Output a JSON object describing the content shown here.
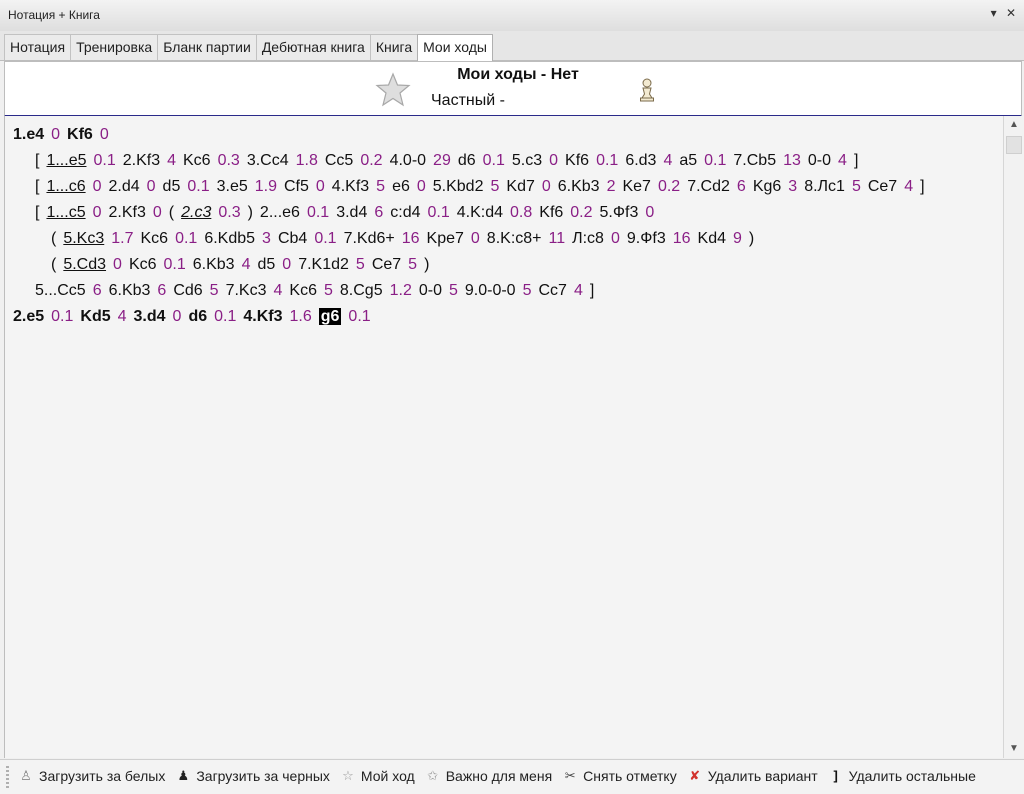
{
  "window": {
    "title": "Нотация + Книга",
    "controls": [
      "▾",
      "✕"
    ]
  },
  "tabs": [
    {
      "label": "Нотация",
      "active": false
    },
    {
      "label": "Тренировка",
      "active": false
    },
    {
      "label": "Бланк партии",
      "active": false
    },
    {
      "label": "Дебютная книга",
      "active": false
    },
    {
      "label": "Книга",
      "active": false
    },
    {
      "label": "Мои ходы",
      "active": true
    }
  ],
  "header": {
    "title": "Мои ходы - Нет",
    "subtitle": "Частный -"
  },
  "notation_lines": [
    {
      "tokens": [
        {
          "t": "1.e4",
          "s": "b"
        },
        {
          "t": "0",
          "c": "w"
        },
        {
          "t": "Kf6",
          "s": "b"
        },
        {
          "t": "0",
          "c": "w"
        }
      ]
    },
    {
      "tokens": [
        {
          "t": "["
        },
        {
          "t": "1...e5",
          "s": "u"
        },
        {
          "t": "0.1",
          "c": "w"
        },
        {
          "t": "2.Kf3"
        },
        {
          "t": "4",
          "c": "w"
        },
        {
          "t": "Kc6"
        },
        {
          "t": "0.3",
          "c": "w"
        },
        {
          "t": "3.Cc4"
        },
        {
          "t": "1.8",
          "c": "w"
        },
        {
          "t": "Cc5"
        },
        {
          "t": "0.2",
          "c": "w"
        },
        {
          "t": "4.0-0"
        },
        {
          "t": "29",
          "c": "w"
        },
        {
          "t": "d6"
        },
        {
          "t": "0.1",
          "c": "w"
        },
        {
          "t": "5.c3"
        },
        {
          "t": "0",
          "c": "w"
        },
        {
          "t": "Kf6"
        },
        {
          "t": "0.1",
          "c": "w"
        },
        {
          "t": "6.d3"
        },
        {
          "t": "4",
          "c": "w"
        },
        {
          "t": "a5"
        },
        {
          "t": "0.1",
          "c": "w"
        },
        {
          "t": "7.Cb5"
        },
        {
          "t": "13",
          "c": "w"
        },
        {
          "t": "0-0"
        },
        {
          "t": "4",
          "c": "w"
        },
        {
          "t": "]"
        }
      ]
    },
    {
      "tokens": [
        {
          "t": "["
        },
        {
          "t": "1...c6",
          "s": "u"
        },
        {
          "t": "0",
          "c": "w"
        },
        {
          "t": "2.d4"
        },
        {
          "t": "0",
          "c": "w"
        },
        {
          "t": "d5"
        },
        {
          "t": "0.1",
          "c": "w"
        },
        {
          "t": "3.e5"
        },
        {
          "t": "1.9",
          "c": "w"
        },
        {
          "t": "Cf5"
        },
        {
          "t": "0",
          "c": "w"
        },
        {
          "t": "4.Kf3"
        },
        {
          "t": "5",
          "c": "w"
        },
        {
          "t": "e6"
        },
        {
          "t": "0",
          "c": "w"
        },
        {
          "t": "5.Kbd2"
        },
        {
          "t": "5",
          "c": "w"
        },
        {
          "t": "Kd7"
        },
        {
          "t": "0",
          "c": "w"
        },
        {
          "t": "6.Kb3"
        },
        {
          "t": "2",
          "c": "w"
        },
        {
          "t": "Ke7"
        },
        {
          "t": "0.2",
          "c": "w"
        },
        {
          "t": "7.Cd2"
        },
        {
          "t": "6",
          "c": "w"
        },
        {
          "t": "Kg6"
        },
        {
          "t": "3",
          "c": "w"
        },
        {
          "t": "8.Лc1"
        },
        {
          "t": "5",
          "c": "w"
        },
        {
          "t": "Ce7"
        },
        {
          "t": "4",
          "c": "w"
        },
        {
          "t": "]"
        }
      ]
    },
    {
      "tokens": [
        {
          "t": "["
        },
        {
          "t": "1...c5",
          "s": "u"
        },
        {
          "t": "0",
          "c": "w"
        },
        {
          "t": "2.Kf3"
        },
        {
          "t": "0",
          "c": "w"
        },
        {
          "t": "("
        },
        {
          "t": "2.c3",
          "s": "ui"
        },
        {
          "t": "0.3",
          "c": "w"
        },
        {
          "t": ")"
        },
        {
          "t": "2...e6"
        },
        {
          "t": "0.1",
          "c": "w"
        },
        {
          "t": "3.d4"
        },
        {
          "t": "6",
          "c": "w"
        },
        {
          "t": "c:d4"
        },
        {
          "t": "0.1",
          "c": "w"
        },
        {
          "t": "4.K:d4"
        },
        {
          "t": "0.8",
          "c": "w"
        },
        {
          "t": "Kf6"
        },
        {
          "t": "0.2",
          "c": "w"
        },
        {
          "t": "5.Фf3"
        },
        {
          "t": "0",
          "c": "w"
        }
      ]
    },
    {
      "tokens": [
        {
          "t": "("
        },
        {
          "t": "5.Kc3",
          "s": "u"
        },
        {
          "t": "1.7",
          "c": "w"
        },
        {
          "t": "Kc6"
        },
        {
          "t": "0.1",
          "c": "w"
        },
        {
          "t": "6.Kdb5"
        },
        {
          "t": "3",
          "c": "w"
        },
        {
          "t": "Cb4"
        },
        {
          "t": "0.1",
          "c": "w"
        },
        {
          "t": "7.Kd6+"
        },
        {
          "t": "16",
          "c": "w"
        },
        {
          "t": "Kpe7"
        },
        {
          "t": "0",
          "c": "w"
        },
        {
          "t": "8.K:c8+"
        },
        {
          "t": "11",
          "c": "w"
        },
        {
          "t": "Л:c8"
        },
        {
          "t": "0",
          "c": "w"
        },
        {
          "t": "9.Фf3"
        },
        {
          "t": "16",
          "c": "w"
        },
        {
          "t": "Kd4"
        },
        {
          "t": "9",
          "c": "w"
        },
        {
          "t": ")"
        }
      ]
    },
    {
      "tokens": [
        {
          "t": "("
        },
        {
          "t": "5.Cd3",
          "s": "u"
        },
        {
          "t": "0",
          "c": "w"
        },
        {
          "t": "Kc6"
        },
        {
          "t": "0.1",
          "c": "w"
        },
        {
          "t": "6.Kb3"
        },
        {
          "t": "4",
          "c": "w"
        },
        {
          "t": "d5"
        },
        {
          "t": "0",
          "c": "w"
        },
        {
          "t": "7.K1d2"
        },
        {
          "t": "5",
          "c": "w"
        },
        {
          "t": "Ce7"
        },
        {
          "t": "5",
          "c": "w"
        },
        {
          "t": ")"
        }
      ]
    },
    {
      "tokens": [
        {
          "t": "5...Cc5"
        },
        {
          "t": "6",
          "c": "w"
        },
        {
          "t": "6.Kb3"
        },
        {
          "t": "6",
          "c": "w"
        },
        {
          "t": "Cd6"
        },
        {
          "t": "5",
          "c": "w"
        },
        {
          "t": "7.Kc3"
        },
        {
          "t": "4",
          "c": "w"
        },
        {
          "t": "Kc6"
        },
        {
          "t": "5",
          "c": "w"
        },
        {
          "t": "8.Cg5"
        },
        {
          "t": "1.2",
          "c": "w"
        },
        {
          "t": "0-0"
        },
        {
          "t": "5",
          "c": "w"
        },
        {
          "t": "9.0-0-0"
        },
        {
          "t": "5",
          "c": "w"
        },
        {
          "t": "Cc7"
        },
        {
          "t": "4",
          "c": "w"
        },
        {
          "t": "]"
        }
      ]
    },
    {
      "tokens": [
        {
          "t": "2.e5",
          "s": "b"
        },
        {
          "t": "0.1",
          "c": "w"
        },
        {
          "t": "Kd5",
          "s": "b"
        },
        {
          "t": "4",
          "c": "w"
        },
        {
          "t": "3.d4",
          "s": "b"
        },
        {
          "t": "0",
          "c": "w"
        },
        {
          "t": "d6",
          "s": "b"
        },
        {
          "t": "0.1",
          "c": "w"
        },
        {
          "t": "4.Kf3",
          "s": "b"
        },
        {
          "t": "1.6",
          "c": "w"
        },
        {
          "t": "g6",
          "s": "hl"
        },
        {
          "t": "0.1",
          "c": "w"
        }
      ]
    }
  ],
  "bottom_buttons": [
    {
      "label": "Загрузить за белых",
      "icon": "white-pawn-icon"
    },
    {
      "label": "Загрузить за черных",
      "icon": "black-pawn-icon"
    },
    {
      "label": "Мой ход",
      "icon": "star-icon"
    },
    {
      "label": "Важно для меня",
      "icon": "star-sparkle-icon"
    },
    {
      "label": "Снять отметку",
      "icon": "cross-tools-icon"
    },
    {
      "label": "Удалить вариант",
      "icon": "red-cross-icon"
    },
    {
      "label": "Удалить остальные",
      "icon": "bracket-icon"
    }
  ],
  "colors": {
    "weight": "#8a1f86",
    "move": "#111111",
    "highlight_bg": "#000000",
    "accent_line": "#2a2a8a"
  }
}
